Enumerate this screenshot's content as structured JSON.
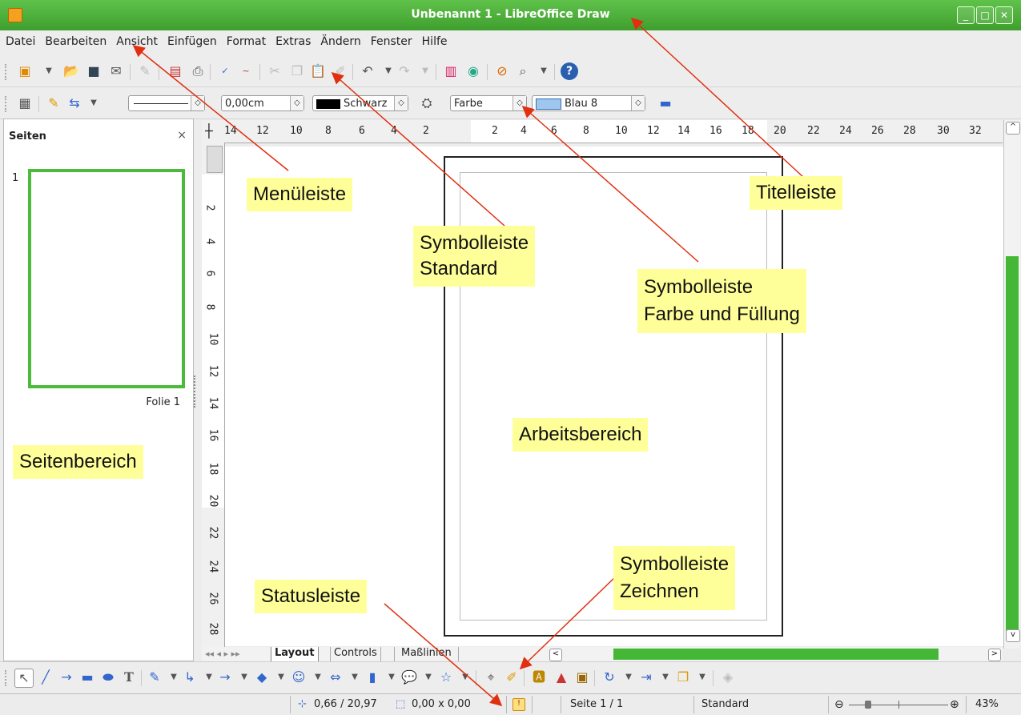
{
  "window": {
    "title": "Unbenannt 1 - LibreOffice Draw"
  },
  "menu": {
    "items": [
      "Datei",
      "Bearbeiten",
      "Ansicht",
      "Einfügen",
      "Format",
      "Extras",
      "Ändern",
      "Fenster",
      "Hilfe"
    ]
  },
  "line_toolbar": {
    "line_width": "0,00cm",
    "line_color": "Schwarz",
    "area_style": "Farbe",
    "area_color": "Blau 8"
  },
  "sidebar": {
    "title": "Seiten",
    "page_number": "1",
    "slide_label": "Folie 1"
  },
  "ruler": {
    "horizontal": [
      "14",
      "12",
      "10",
      "8",
      "6",
      "4",
      "2",
      "2",
      "4",
      "6",
      "8",
      "10",
      "12",
      "14",
      "16",
      "18",
      "20",
      "22",
      "24",
      "26",
      "28",
      "30",
      "32"
    ],
    "vertical": [
      "2",
      "4",
      "6",
      "8",
      "10",
      "12",
      "14",
      "16",
      "18",
      "20",
      "22",
      "24",
      "26",
      "28"
    ]
  },
  "tabs": [
    "Layout",
    "Controls",
    "Maßlinien"
  ],
  "status": {
    "position": "0,66 / 20,97",
    "size": "0,00 x 0,00",
    "page": "Seite 1 / 1",
    "layout": "Standard",
    "zoom": "43%"
  },
  "annotations": {
    "menuleiste": "Menüleiste",
    "titelleiste": "Titelleiste",
    "symbolleiste_standard_1": "Symbolleiste",
    "symbolleiste_standard_2": "Standard",
    "symbolleiste_farbe_1": "Symbolleiste",
    "symbolleiste_farbe_2": "Farbe und Füllung",
    "arbeitsbereich": "Arbeitsbereich",
    "seitenbereich": "Seitenbereich",
    "statusleiste": "Statusleiste",
    "symbolleiste_zeichnen_1": "Symbolleiste",
    "symbolleiste_zeichnen_2": "Zeichnen"
  },
  "colors": {
    "titlebar": "#4caf38",
    "annotation_bg": "#ffff99",
    "arrow": "#e03010",
    "page_frame": "#4cbb3c"
  }
}
